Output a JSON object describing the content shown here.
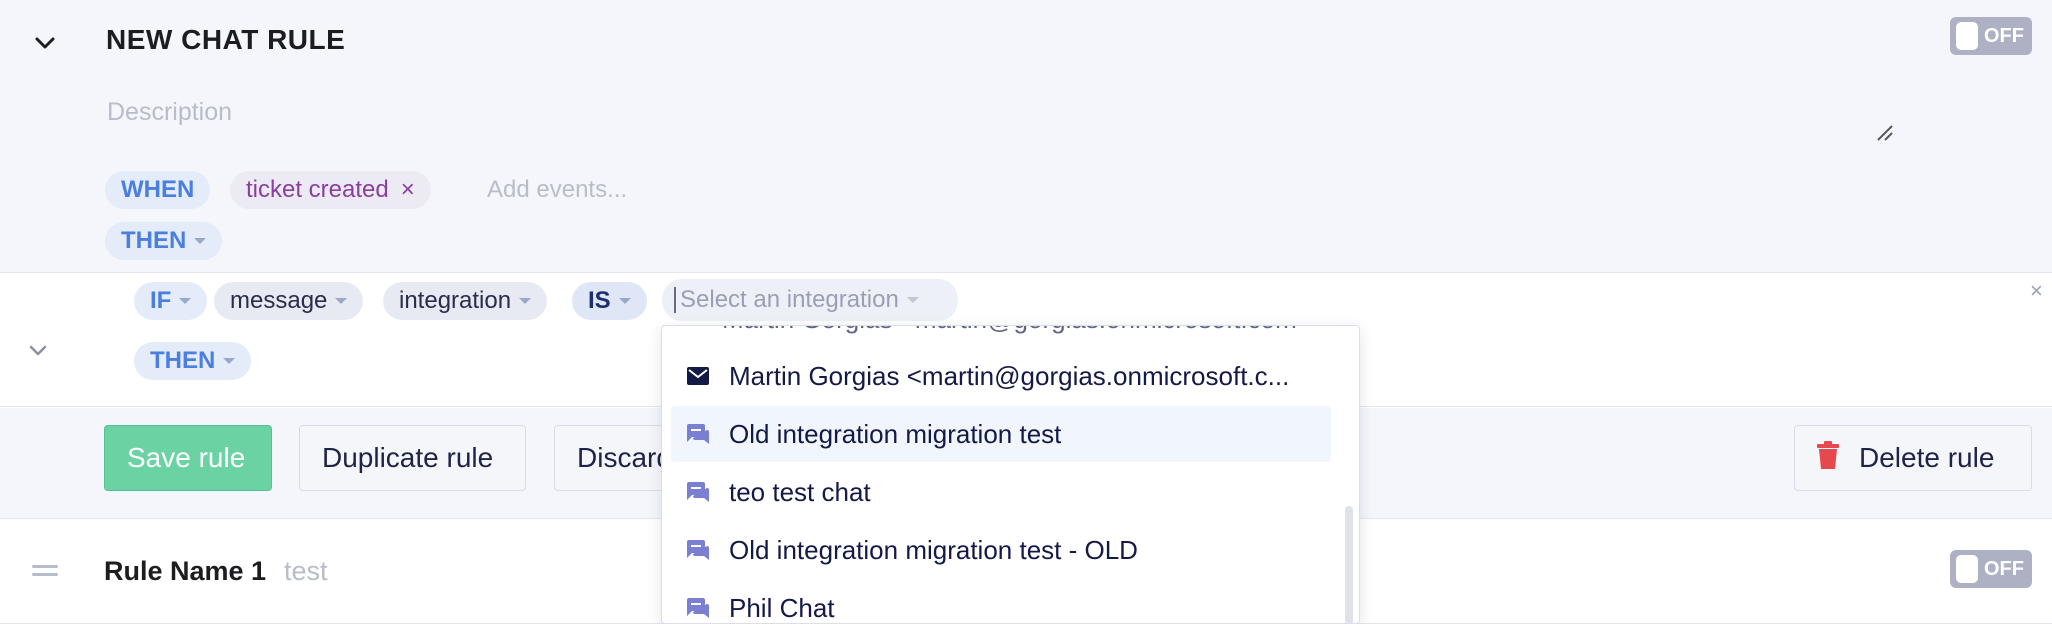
{
  "rule": {
    "title": "NEW CHAT RULE",
    "toggle_label": "OFF",
    "description_placeholder": "Description",
    "when_label": "WHEN",
    "event_chip": "ticket created",
    "event_remove": "×",
    "add_events_placeholder": "Add events...",
    "then_label": "THEN"
  },
  "condition": {
    "if_label": "IF",
    "field1": "message",
    "field2": "integration",
    "operator": "IS",
    "select_placeholder": "Select an integration",
    "then_label": "THEN",
    "remove": "×"
  },
  "actions": {
    "save": "Save rule",
    "duplicate": "Duplicate rule",
    "discard": "Discard",
    "delete": "Delete rule"
  },
  "next_rule": {
    "name": "Rule Name 1",
    "description": "test",
    "toggle_label": "OFF"
  },
  "dropdown": {
    "partial_item": "Martin Gorgias <martin@gorgias.onmicrosoft.com>",
    "items": [
      {
        "label": "Martin Gorgias <martin@gorgias.onmicrosoft.c...",
        "icon": "email-icon",
        "hover": false
      },
      {
        "label": "Old integration migration test",
        "icon": "chat-icon",
        "hover": true
      },
      {
        "label": "teo test chat",
        "icon": "chat-icon",
        "hover": false
      },
      {
        "label": "Old integration migration test - OLD",
        "icon": "chat-icon",
        "hover": false
      },
      {
        "label": "Phil Chat",
        "icon": "chat-icon",
        "hover": false
      }
    ]
  },
  "colors": {
    "accent_green": "#6bd3a3",
    "keyword_blue": "#4a7fe0",
    "event_purple": "#8a3f9e",
    "danger_red": "#e5484d",
    "icon_purple": "#7b7fd1"
  }
}
